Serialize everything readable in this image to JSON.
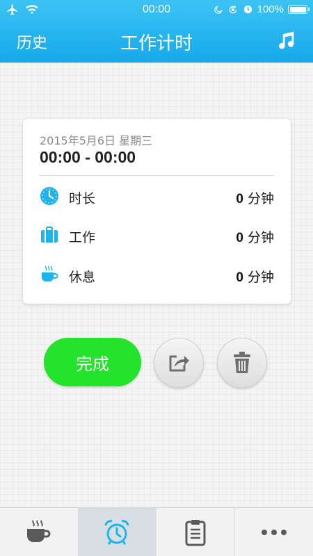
{
  "status_bar": {
    "time": "00:00",
    "battery": "100%",
    "icons": [
      "airplane-icon",
      "wifi-icon",
      "moon-icon",
      "orientation-lock-icon",
      "alarm-icon",
      "battery-icon"
    ]
  },
  "nav": {
    "history_label": "历史",
    "title": "工作计时",
    "music_icon": "music-note-icon"
  },
  "summary": {
    "date": "2015年5月6日 星期三",
    "time_range": "00:00 - 00:00",
    "stats": [
      {
        "label": "时长",
        "value": "0",
        "unit": "分钟",
        "icon": "clock-icon"
      },
      {
        "label": "工作",
        "value": "0",
        "unit": "分钟",
        "icon": "briefcase-icon"
      },
      {
        "label": "休息",
        "value": "0",
        "unit": "分钟",
        "icon": "coffee-cup-icon"
      }
    ]
  },
  "actions": {
    "finish_label": "完成",
    "share_icon": "share-icon",
    "delete_icon": "trash-icon"
  },
  "tabs": [
    {
      "icon": "coffee-cup-icon",
      "active": false
    },
    {
      "icon": "alarm-clock-icon",
      "active": true
    },
    {
      "icon": "clipboard-icon",
      "active": false
    },
    {
      "icon": "more-icon",
      "active": false
    }
  ],
  "colors": {
    "header": "#1eb2ee",
    "accent_blue": "#1eb2ee",
    "finish_green": "#23e32a",
    "active_tab": "#d7dfe4"
  }
}
